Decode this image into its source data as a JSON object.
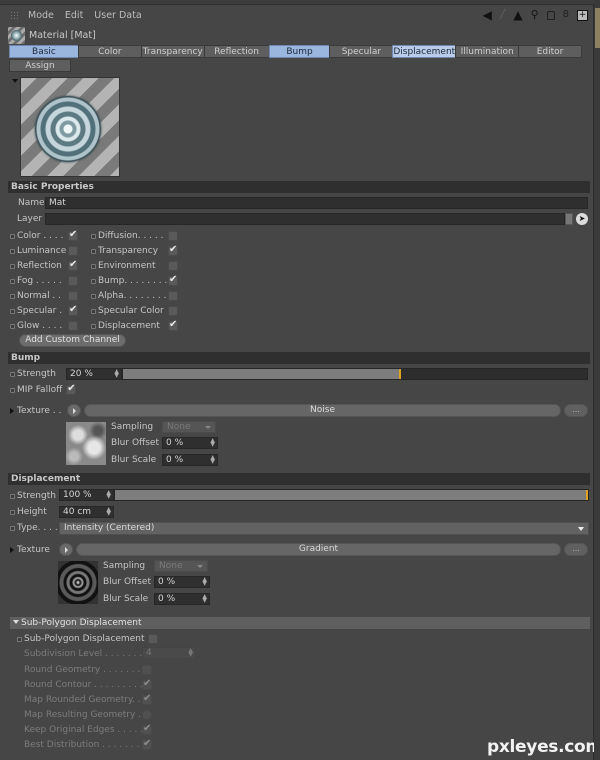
{
  "menubar": {
    "items": [
      "Mode",
      "Edit",
      "User Data"
    ]
  },
  "toolbar_icons": [
    "back-arrow-icon",
    "up-arrow-icon",
    "search-icon",
    "lock-icon",
    "link-icon",
    "new-window-icon"
  ],
  "title": "Material [Mat]",
  "tabs": {
    "row1": [
      {
        "label": "Basic",
        "selected": true
      },
      {
        "label": "Color",
        "selected": false
      },
      {
        "label": "Transparency",
        "selected": false
      },
      {
        "label": "Reflection",
        "selected": false
      },
      {
        "label": "Bump",
        "selected": true
      },
      {
        "label": "Specular",
        "selected": false
      },
      {
        "label": "Displacement",
        "selected": true
      },
      {
        "label": "Illumination",
        "selected": false
      },
      {
        "label": "Editor",
        "selected": false
      }
    ],
    "row2": [
      {
        "label": "Assign",
        "selected": false
      }
    ]
  },
  "basic": {
    "header": "Basic Properties",
    "name_label": "Name",
    "name_value": "Mat",
    "layer_label": "Layer",
    "layer_value": "",
    "channels_left": [
      {
        "label": "Color . . . .",
        "checked": true
      },
      {
        "label": "Luminance",
        "checked": false
      },
      {
        "label": "Reflection",
        "checked": true
      },
      {
        "label": "Fog . . . . .",
        "checked": false
      },
      {
        "label": "Normal . .",
        "checked": false
      },
      {
        "label": "Specular .",
        "checked": true
      },
      {
        "label": "Glow . . . .",
        "checked": false
      }
    ],
    "channels_right": [
      {
        "label": "Diffusion. . . . .",
        "checked": false
      },
      {
        "label": "Transparency",
        "checked": true
      },
      {
        "label": "Environment",
        "checked": false
      },
      {
        "label": "Bump. . . . . . . .",
        "checked": true
      },
      {
        "label": "Alpha. . . . . . . .",
        "checked": false
      },
      {
        "label": "Specular Color",
        "checked": false
      },
      {
        "label": "Displacement",
        "checked": true
      }
    ],
    "add_channel_label": "Add Custom Channel"
  },
  "bump": {
    "header": "Bump",
    "strength_label": "Strength",
    "strength_value": "20 %",
    "strength_slider_fraction": 0.6,
    "mip_label": "MIP Falloff",
    "mip_checked": true,
    "texture_label": "Texture . .",
    "texture_name": "Noise",
    "more_label": "...",
    "sampling_label": "Sampling",
    "sampling_value": "None",
    "blur_offset_label": "Blur Offset",
    "blur_offset_value": "0 %",
    "blur_scale_label": "Blur Scale",
    "blur_scale_value": "0 %"
  },
  "displacement": {
    "header": "Displacement",
    "strength_label": "Strength",
    "strength_value": "100 %",
    "strength_slider_fraction": 1.0,
    "height_label": "Height",
    "height_value": "40 cm",
    "type_label": "Type. . . .",
    "type_value": "Intensity (Centered)",
    "texture_label": "Texture",
    "texture_name": "Gradient",
    "more_label": "...",
    "sampling_label": "Sampling",
    "sampling_value": "None",
    "blur_offset_label": "Blur Offset",
    "blur_offset_value": "0 %",
    "blur_scale_label": "Blur Scale",
    "blur_scale_value": "0 %"
  },
  "subpoly": {
    "header": "Sub-Polygon Displacement",
    "enable_label": "Sub-Polygon Displacement",
    "enable_checked": false,
    "subdivision_label": "Subdivision Level . . . . . . . .",
    "subdivision_value": "4",
    "options": [
      {
        "label": "Round Geometry . . . . . . . .",
        "checked": false,
        "round": false
      },
      {
        "label": "Round Contour . . . . . . . . .",
        "checked": true,
        "round": false
      },
      {
        "label": "Map Rounded Geometry. .",
        "checked": true,
        "round": false
      },
      {
        "label": "Map Resulting Geometry .",
        "checked": false,
        "round": true
      },
      {
        "label": "Keep Original Edges . . . . .",
        "checked": true,
        "round": false
      },
      {
        "label": "Best Distribution . . . . . . . .",
        "checked": true,
        "round": false
      }
    ]
  },
  "watermark": "pxleyes.com"
}
